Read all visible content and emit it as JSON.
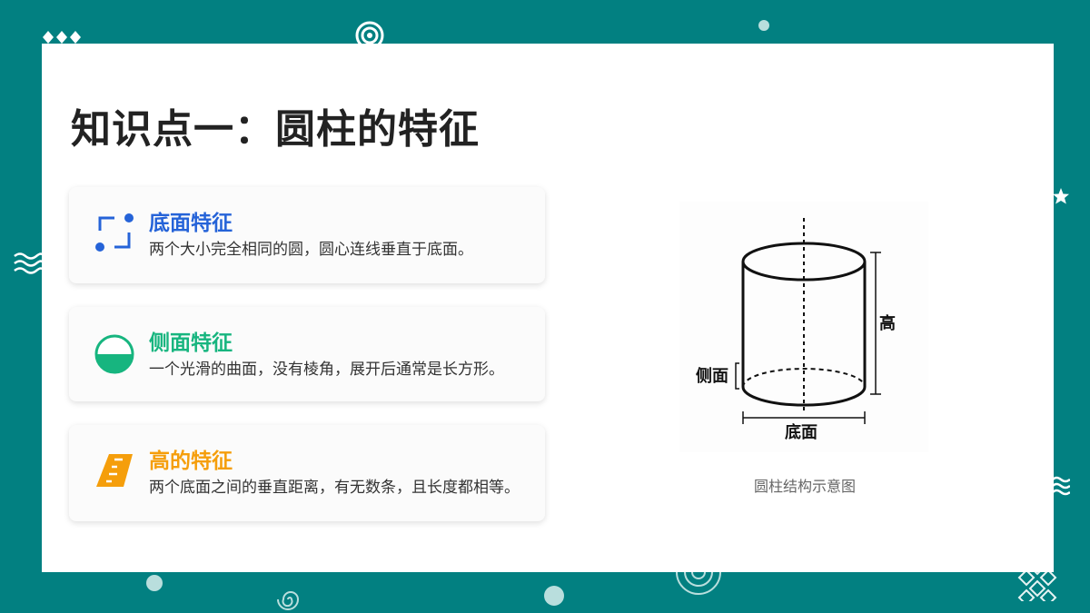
{
  "slide": {
    "title": "知识点一：圆柱的特征"
  },
  "features": [
    {
      "title": "底面特征",
      "description": "两个大小完全相同的圆，圆心连线垂直于底面。",
      "color": "#2563d8",
      "icon": "square-corners-icon"
    },
    {
      "title": "侧面特征",
      "description": "一个光滑的曲面，没有棱角，展开后通常是长方形。",
      "color": "#17b57f",
      "icon": "half-filled-circle-icon"
    },
    {
      "title": "高的特征",
      "description": "两个底面之间的垂直距离，有无数条，且长度都相等。",
      "color": "#f59e0b",
      "icon": "ruler-icon"
    }
  ],
  "diagram": {
    "label_height": "高",
    "label_side": "侧面",
    "label_base": "底面",
    "caption": "圆柱结构示意图"
  },
  "colors": {
    "background": "#028081",
    "slide": "#ffffff",
    "title": "#222222"
  }
}
